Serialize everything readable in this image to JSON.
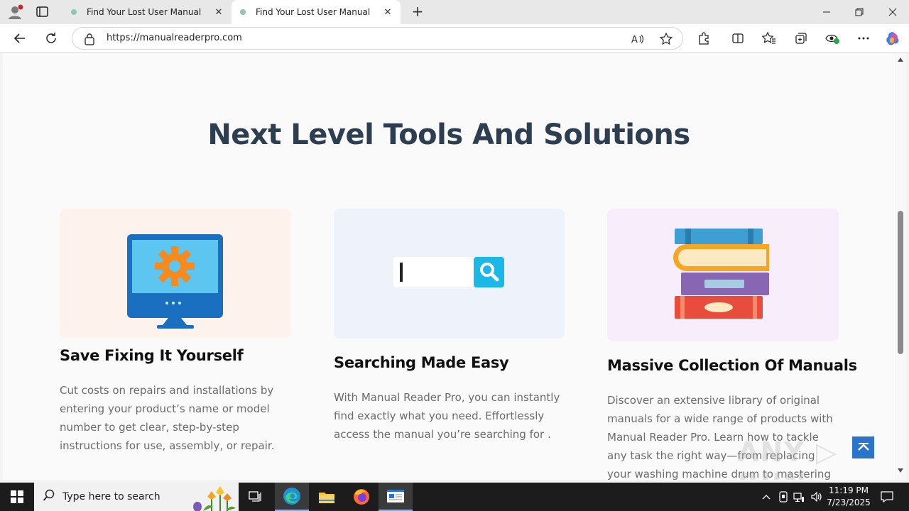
{
  "browser": {
    "tabs": [
      {
        "label": "Find Your Lost User Manual",
        "active": false
      },
      {
        "label": "Find Your Lost User Manual",
        "active": true
      }
    ],
    "url": "https://manualreaderpro.com"
  },
  "page": {
    "headline": "Next Level Tools And Solutions",
    "cards": [
      {
        "title": "Save Fixing It Yourself",
        "text": "Cut costs on repairs and installations by entering your product’s name or model number to get clear, step-by-step instructions for use, assembly, or repair.",
        "image_icon": "computer-gear-icon",
        "bg": "#fdf3ec"
      },
      {
        "title": "Searching Made Easy",
        "text": "With Manual Reader Pro, you can instantly find exactly what you need. Effortlessly access the manual you’re searching for .",
        "image_icon": "search-bar-icon",
        "bg": "#eef3fb"
      },
      {
        "title": "Massive Collection Of Manuals",
        "text": "Discover an extensive library of original manuals for a wide range of products with Manual Reader Pro. Learn how to tackle any task the right way—from replacing your washing machine drum to mastering your",
        "image_icon": "book-stack-icon",
        "bg": "#f8eefb"
      }
    ],
    "watermark": "ANY RUN"
  },
  "taskbar": {
    "search_placeholder": "Type here to search",
    "time": "11:19 PM",
    "date": "7/23/2025"
  },
  "colors": {
    "headline": "#2d3e50",
    "accent_blue": "#2a74c9",
    "monitor_blue": "#1a6fc0",
    "search_cyan": "#1bb7e6"
  }
}
